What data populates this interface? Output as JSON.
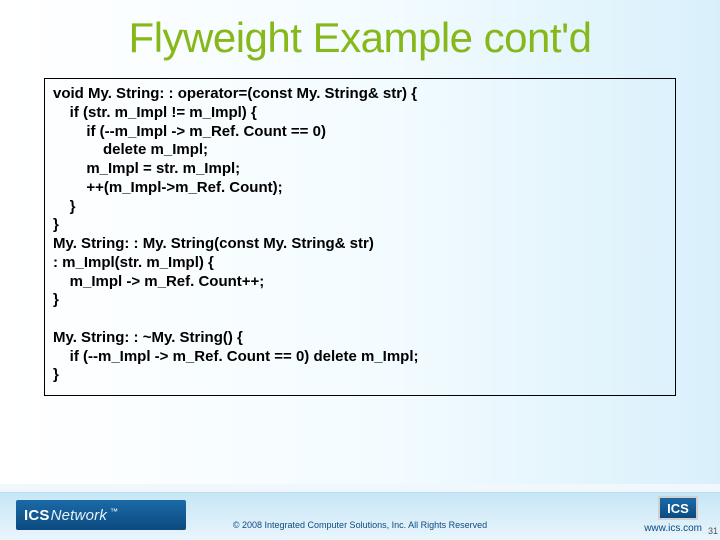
{
  "title": "Flyweight Example cont'd",
  "code": "void My. String: : operator=(const My. String& str) {\n    if (str. m_Impl != m_Impl) {\n        if (--m_Impl -> m_Ref. Count == 0)\n            delete m_Impl;\n        m_Impl = str. m_Impl;\n        ++(m_Impl->m_Ref. Count);\n    }\n}\nMy. String: : My. String(const My. String& str)\n: m_Impl(str. m_Impl) {\n    m_Impl -> m_Ref. Count++;\n}\n\nMy. String: : ~My. String() {\n    if (--m_Impl -> m_Ref. Count == 0) delete m_Impl;\n}",
  "footer": {
    "logo_left_a": "ICS",
    "logo_left_b": "Network",
    "tm": "™",
    "copyright": "© 2008 Integrated Computer Solutions, Inc. All Rights Reserved",
    "logo_right": "ICS",
    "url": "www.ics.com",
    "page": "31"
  }
}
